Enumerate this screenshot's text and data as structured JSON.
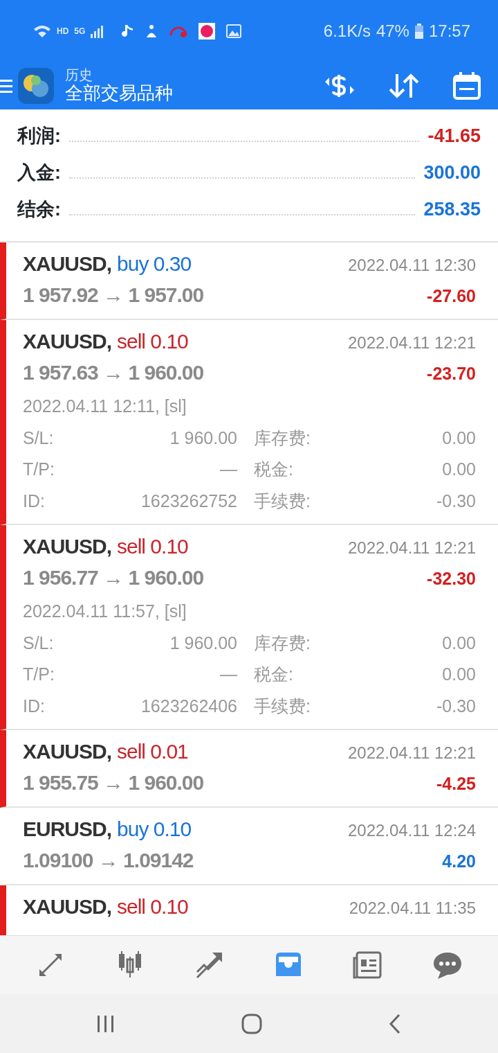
{
  "status_bar": {
    "network_labels": [
      "HD",
      "5G"
    ],
    "speed": "6.1K/s",
    "battery": "47%",
    "time": "17:57"
  },
  "header": {
    "subtitle": "历史",
    "title": "全部交易品种"
  },
  "summary": [
    {
      "label": "利润:",
      "value": "-41.65",
      "negative": true
    },
    {
      "label": "入金:",
      "value": "300.00",
      "negative": false
    },
    {
      "label": "结余:",
      "value": "258.35",
      "negative": false
    }
  ],
  "trades": [
    {
      "symbol": "XAUUSD,",
      "kind": "buy",
      "side": "buy 0.30",
      "time": "2022.04.11 12:30",
      "prices": "1 957.92 → 1 957.00",
      "profit": "-27.60",
      "loss": true,
      "expanded": false
    },
    {
      "symbol": "XAUUSD,",
      "kind": "sell",
      "side": "sell 0.10",
      "time": "2022.04.11 12:21",
      "prices": "1 957.63 → 1 960.00",
      "profit": "-23.70",
      "loss": true,
      "expanded": true,
      "open_time": "2022.04.11 12:11, [sl]",
      "details": [
        {
          "label": "S/L:",
          "value": "1 960.00",
          "label2": "库存费:",
          "value2": "0.00"
        },
        {
          "label": "T/P:",
          "value": "—",
          "label2": "税金:",
          "value2": "0.00"
        },
        {
          "label": "ID:",
          "value": "1623262752",
          "label2": "手续费:",
          "value2": "-0.30"
        }
      ]
    },
    {
      "symbol": "XAUUSD,",
      "kind": "sell",
      "side": "sell 0.10",
      "time": "2022.04.11 12:21",
      "prices": "1 956.77 → 1 960.00",
      "profit": "-32.30",
      "loss": true,
      "expanded": true,
      "open_time": "2022.04.11 11:57, [sl]",
      "details": [
        {
          "label": "S/L:",
          "value": "1 960.00",
          "label2": "库存费:",
          "value2": "0.00"
        },
        {
          "label": "T/P:",
          "value": "—",
          "label2": "税金:",
          "value2": "0.00"
        },
        {
          "label": "ID:",
          "value": "1623262406",
          "label2": "手续费:",
          "value2": "-0.30"
        }
      ]
    },
    {
      "symbol": "XAUUSD,",
      "kind": "sell",
      "side": "sell 0.01",
      "time": "2022.04.11 12:21",
      "prices": "1 955.75 → 1 960.00",
      "profit": "-4.25",
      "loss": true,
      "expanded": false
    },
    {
      "symbol": "EURUSD,",
      "kind": "buy",
      "side": "buy 0.10",
      "time": "2022.04.11 12:24",
      "prices": "1.09100 → 1.09142",
      "profit": "4.20",
      "loss": false,
      "expanded": false
    },
    {
      "symbol": "XAUUSD,",
      "kind": "sell",
      "side": "sell 0.10",
      "time": "2022.04.11 11:35",
      "loss": true,
      "expanded": false
    }
  ],
  "nav": [
    {
      "selected": false
    },
    {
      "selected": false
    },
    {
      "selected": false
    },
    {
      "selected": true
    },
    {
      "selected": false
    },
    {
      "selected": false
    }
  ]
}
